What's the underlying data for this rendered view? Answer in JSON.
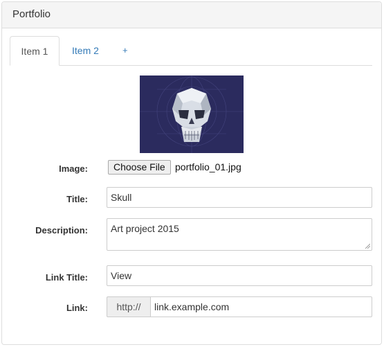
{
  "panel": {
    "title": "Portfolio"
  },
  "tabs": [
    {
      "label": "Item 1",
      "active": true
    },
    {
      "label": "Item 2",
      "active": false
    },
    {
      "label": "+",
      "active": false
    }
  ],
  "form": {
    "image": {
      "label": "Image:",
      "button_label": "Choose File",
      "file_name": "portfolio_01.jpg",
      "preview_icon": "skull-icon"
    },
    "title": {
      "label": "Title:",
      "value": "Skull"
    },
    "description": {
      "label": "Description:",
      "value": "Art project 2015"
    },
    "link_title": {
      "label": "Link Title:",
      "value": "View"
    },
    "link": {
      "label": "Link:",
      "prefix": "http://",
      "value": "link.example.com"
    }
  },
  "colors": {
    "link": "#337ab7",
    "preview_bg": "#2b2b5e"
  }
}
